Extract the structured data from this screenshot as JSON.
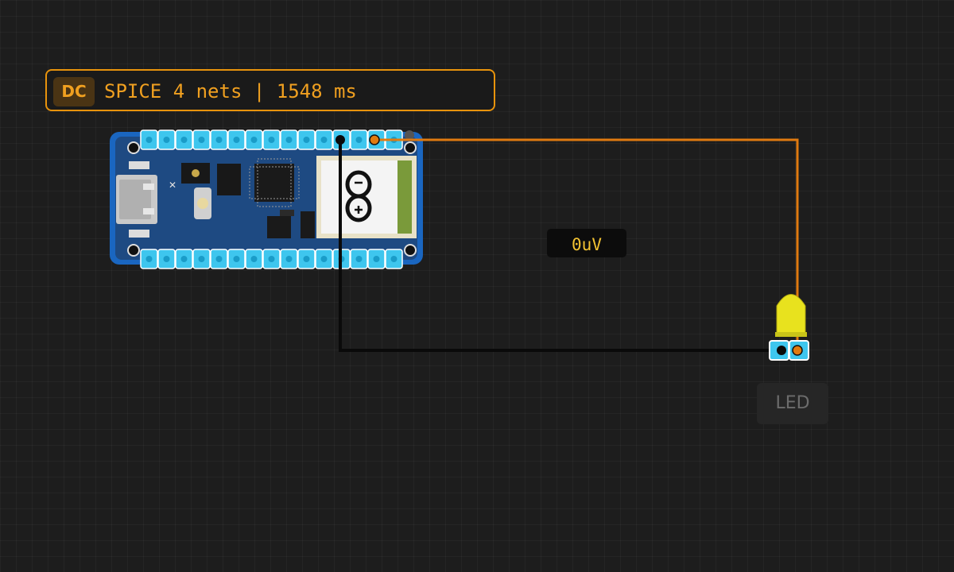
{
  "simulation": {
    "mode_badge": "DC",
    "status_text": "SPICE 4 nets | 1548 ms"
  },
  "probe": {
    "reading": "0uV"
  },
  "components": {
    "board": {
      "name": "arduino-nano-board"
    },
    "led": {
      "label": "LED",
      "color": "#e8e21e"
    }
  },
  "wires": [
    {
      "name": "orange-wire",
      "color": "#e07a10"
    },
    {
      "name": "black-wire",
      "color": "#0a0a0a"
    }
  ],
  "colors": {
    "accent": "#e8930c",
    "pin_header": "#3ec6ee",
    "board": "#1e4a8a",
    "background": "#1d1d1d"
  }
}
